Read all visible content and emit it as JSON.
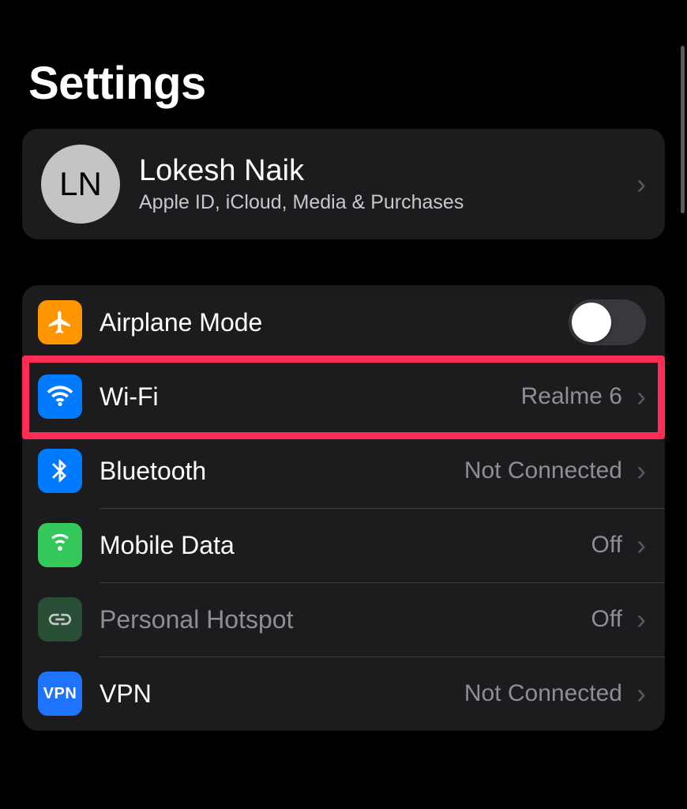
{
  "header": {
    "title": "Settings"
  },
  "profile": {
    "initials": "LN",
    "name": "Lokesh Naik",
    "subtitle": "Apple ID, iCloud, Media & Purchases"
  },
  "rows": {
    "airplane": {
      "label": "Airplane Mode",
      "toggled": false
    },
    "wifi": {
      "label": "Wi-Fi",
      "value": "Realme 6"
    },
    "bluetooth": {
      "label": "Bluetooth",
      "value": "Not Connected"
    },
    "mobile": {
      "label": "Mobile Data",
      "value": "Off"
    },
    "hotspot": {
      "label": "Personal Hotspot",
      "value": "Off"
    },
    "vpn": {
      "label": "VPN",
      "badge": "VPN",
      "value": "Not Connected"
    }
  }
}
